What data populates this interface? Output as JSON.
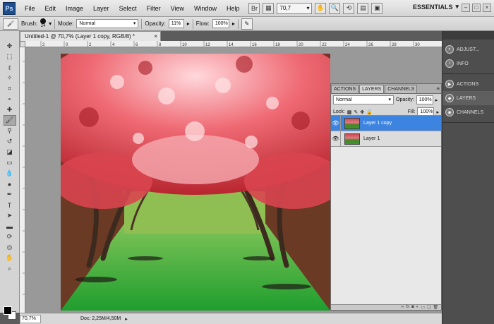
{
  "menubar": {
    "logo": "Ps",
    "items": [
      "File",
      "Edit",
      "Image",
      "Layer",
      "Select",
      "Filter",
      "View",
      "Window",
      "Help"
    ],
    "zoom": "70,7",
    "workspace": "ESSENTIALS"
  },
  "options": {
    "brush_label": "Brush:",
    "brush_size": "24",
    "mode_label": "Mode:",
    "mode_value": "Normal",
    "opacity_label": "Opacity:",
    "opacity_value": "11%",
    "flow_label": "Flow:",
    "flow_value": "100%"
  },
  "document": {
    "tab_title": "Untitled-1 @ 70,7% (Layer 1 copy, RGB/8) *",
    "ruler_ticks": [
      "2",
      "0",
      "2",
      "4",
      "6",
      "8",
      "10",
      "12",
      "14",
      "16",
      "18",
      "20",
      "22",
      "24",
      "26",
      "28",
      "30"
    ]
  },
  "status": {
    "zoom": "70,7%",
    "doc_info": "Doc: 2,25M/4,50M"
  },
  "layers_panel": {
    "tabs": [
      "ACTIONS",
      "LAYERS",
      "CHANNELS"
    ],
    "active_tab": "LAYERS",
    "blend_mode": "Normal",
    "opacity_label": "Opacity:",
    "opacity_value": "100%",
    "lock_label": "Lock:",
    "fill_label": "Fill:",
    "fill_value": "100%",
    "layers": [
      {
        "name": "Layer 1 copy",
        "selected": true
      },
      {
        "name": "Layer 1",
        "selected": false
      }
    ]
  },
  "dock": {
    "items": [
      "ADJUST...",
      "INFO",
      "ACTIONS",
      "LAYERS",
      "CHANNELS"
    ]
  },
  "colors": {
    "selection": "#3d83e0",
    "foreground": "#000000",
    "background": "#ffffff"
  }
}
